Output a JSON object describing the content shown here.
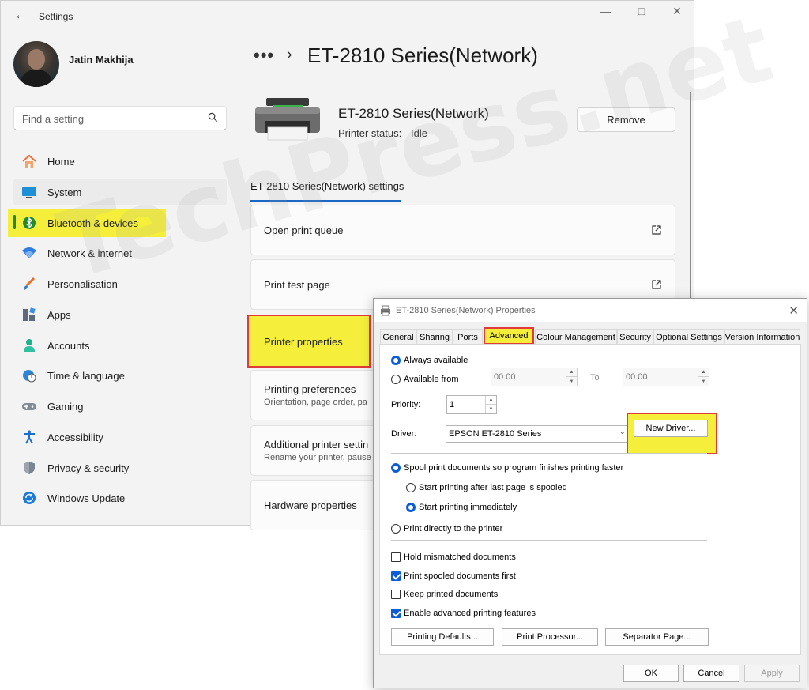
{
  "settings": {
    "window_title": "Settings",
    "user_name": "Jatin Makhija",
    "search_placeholder": "Find a setting",
    "nav": [
      {
        "label": "Home",
        "icon": "home-icon"
      },
      {
        "label": "System",
        "icon": "system-icon"
      },
      {
        "label": "Bluetooth & devices",
        "icon": "bluetooth-icon"
      },
      {
        "label": "Network & internet",
        "icon": "wifi-icon"
      },
      {
        "label": "Personalisation",
        "icon": "brush-icon"
      },
      {
        "label": "Apps",
        "icon": "apps-icon"
      },
      {
        "label": "Accounts",
        "icon": "person-icon"
      },
      {
        "label": "Time & language",
        "icon": "globe-clock-icon"
      },
      {
        "label": "Gaming",
        "icon": "gamepad-icon"
      },
      {
        "label": "Accessibility",
        "icon": "accessibility-icon"
      },
      {
        "label": "Privacy & security",
        "icon": "shield-icon"
      },
      {
        "label": "Windows Update",
        "icon": "update-icon"
      }
    ],
    "breadcrumb_more": "•••",
    "breadcrumb_sep": "›",
    "page_title": "ET-2810 Series(Network)",
    "printer": {
      "name": "ET-2810 Series(Network)",
      "status_label": "Printer status:",
      "status_value": "Idle",
      "remove_label": "Remove"
    },
    "settings_tab": "ET-2810 Series(Network) settings",
    "cards": [
      {
        "title": "Open print queue",
        "desc": ""
      },
      {
        "title": "Print test page",
        "desc": ""
      },
      {
        "title": "Printer properties",
        "desc": ""
      },
      {
        "title": "Printing preferences",
        "desc": "Orientation, page order, pa"
      },
      {
        "title": "Additional printer settin",
        "desc": "Rename your printer, pause"
      },
      {
        "title": "Hardware properties",
        "desc": ""
      }
    ]
  },
  "watermark": "TechPress.net",
  "dialog": {
    "title": "ET-2810 Series(Network) Properties",
    "tabs": [
      "General",
      "Sharing",
      "Ports",
      "Advanced",
      "Colour Management",
      "Security",
      "Optional Settings",
      "Version Information"
    ],
    "active_tab": "Advanced",
    "always_available": "Always available",
    "available_from": "Available from",
    "from_time": "00:00",
    "to_label": "To",
    "to_time": "00:00",
    "priority_label": "Priority:",
    "priority_value": "1",
    "driver_label": "Driver:",
    "driver_value": "EPSON ET-2810 Series",
    "new_driver": "New Driver...",
    "spool": "Spool print documents so program finishes printing faster",
    "start_after_last": "Start printing after last page is spooled",
    "start_immediately": "Start printing immediately",
    "print_directly": "Print directly to the printer",
    "hold_mismatched": "Hold mismatched documents",
    "print_spooled_first": "Print spooled documents first",
    "keep_printed": "Keep printed documents",
    "enable_advanced": "Enable advanced printing features",
    "printing_defaults": "Printing Defaults...",
    "print_processor": "Print Processor...",
    "separator_page": "Separator Page...",
    "ok": "OK",
    "cancel": "Cancel",
    "apply": "Apply",
    "state": {
      "always_available": true,
      "spool": true,
      "start_immediately": true,
      "hold_mismatched": false,
      "print_spooled_first": true,
      "keep_printed": false,
      "enable_advanced": true
    }
  },
  "colors": {
    "highlight_yellow": "#f5ef3c",
    "highlight_red": "#e03a3a",
    "accent_blue": "#0b5cd5",
    "selection_green": "#1f8a2e"
  }
}
